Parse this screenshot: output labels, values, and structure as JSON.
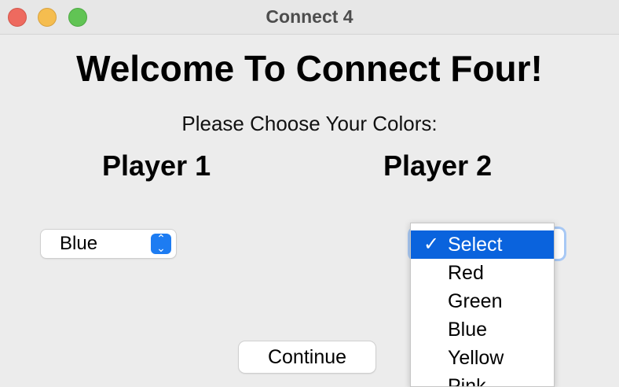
{
  "window": {
    "title": "Connect 4"
  },
  "content": {
    "welcome": "Welcome To Connect Four!",
    "subtitle": "Please Choose Your Colors:",
    "player1_label": "Player 1",
    "player2_label": "Player 2"
  },
  "player1_select": {
    "value": "Blue"
  },
  "player2_select": {
    "value": "Select",
    "options": [
      "Select",
      "Red",
      "Green",
      "Blue",
      "Yellow",
      "Pink"
    ],
    "selected_index": 0
  },
  "buttons": {
    "continue": "Continue"
  },
  "icons": {
    "check": "✓",
    "stepper_up": "⌃",
    "stepper_down": "⌄"
  },
  "colors": {
    "accent": "#0a63dd",
    "close": "#ee6a5f",
    "minimize": "#f5bd4f",
    "maximize": "#61c454"
  }
}
